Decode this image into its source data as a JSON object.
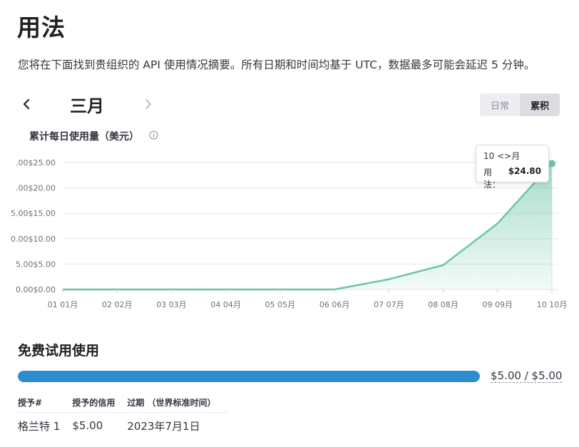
{
  "page": {
    "title": "用法",
    "description": "您将在下面找到贵组织的 API 使用情况摘要。所有日期和时间均基于 UTC，数据最多可能会延迟 5 分钟。"
  },
  "month_nav": {
    "label": "三月",
    "prev_icon": "chevron-left-icon",
    "next_icon": "chevron-right-icon"
  },
  "view_toggle": {
    "options": [
      "日常",
      "累积"
    ],
    "selected": "累积"
  },
  "chart": {
    "title": "累计每日使用量（美元）",
    "info_icon": "info-icon",
    "tooltip": {
      "date": "10 <>月",
      "label": "用法：",
      "value": "$24.80"
    }
  },
  "chart_data": {
    "type": "area",
    "x": [
      "01 01月",
      "02 02月",
      "03 03月",
      "04 04月",
      "05 05月",
      "06 06月",
      "07 07月",
      "08 08月",
      "09 09月",
      "10 10月"
    ],
    "series": [
      {
        "values": [
          0,
          0,
          0,
          0,
          0,
          0,
          2.0,
          4.8,
          13.0,
          24.8
        ]
      }
    ],
    "y_ticks": [
      ".00$25.00",
      ".00$20.00",
      "5.00$15.00",
      "0.00$10.00",
      "5.00$5.00",
      "0.00$0.00"
    ],
    "ylim": [
      0,
      25
    ],
    "grid": true,
    "colors": {
      "line": "#6cc5a9",
      "fill": "#9fd9c6",
      "grid": "#e5e5ea"
    }
  },
  "free_trial": {
    "title": "免费试用使用",
    "used_fraction": 1.0,
    "usage_text": "$5.00 / $5.00",
    "bar_color": "#2d8dd2"
  },
  "grants": {
    "headers": [
      "授予#",
      "授予的信用",
      "过期 （世界标准时间）"
    ],
    "rows": [
      [
        "格兰特 1",
        "$5.00",
        "2023年7月1日"
      ]
    ]
  }
}
